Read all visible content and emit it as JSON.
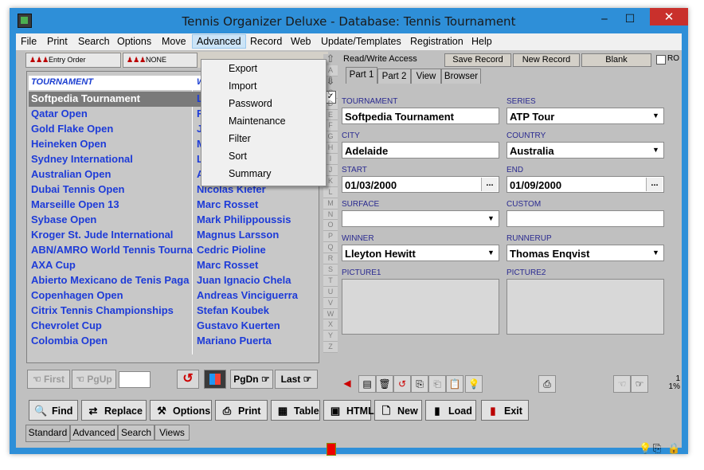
{
  "window": {
    "title": "Tennis Organizer Deluxe - Database: Tennis Tournament",
    "controls": {
      "minimize": "‒",
      "maximize": "☐",
      "close": "✕"
    }
  },
  "menu": [
    "File",
    "Print",
    "Search",
    "Options",
    "Move",
    "Advanced",
    "Record",
    "Web",
    "Update/Templates",
    "Registration",
    "Help"
  ],
  "advanced_menu": [
    "Export",
    "Import",
    "Password",
    "Maintenance",
    "Filter",
    "Sort",
    "Summary"
  ],
  "sort": {
    "entry_order": "Entry Order",
    "none": "NONE"
  },
  "grid": {
    "headers": [
      "TOURNAMENT",
      "W"
    ],
    "rows": [
      {
        "tournament": "Softpedia Tournament",
        "winner": "L"
      },
      {
        "tournament": "Qatar Open",
        "winner": "F"
      },
      {
        "tournament": "Gold Flake Open",
        "winner": "J"
      },
      {
        "tournament": "Heineken Open",
        "winner": "M"
      },
      {
        "tournament": "Sydney International",
        "winner": "L"
      },
      {
        "tournament": "Australian Open",
        "winner": "A"
      },
      {
        "tournament": "Dubai Tennis Open",
        "winner": "Nicolas Kiefer"
      },
      {
        "tournament": "Marseille Open 13",
        "winner": "Marc Rosset"
      },
      {
        "tournament": "Sybase Open",
        "winner": "Mark Philippoussis"
      },
      {
        "tournament": "Kroger St. Jude International",
        "winner": "Magnus Larsson"
      },
      {
        "tournament": "ABN/AMRO World Tennis Tourna",
        "winner": "Cedric Pioline"
      },
      {
        "tournament": "AXA Cup",
        "winner": "Marc Rosset"
      },
      {
        "tournament": "Abierto Mexicano de Tenis Paga",
        "winner": "Juan Ignacio Chela"
      },
      {
        "tournament": "Copenhagen Open",
        "winner": "Andreas Vinciguerra"
      },
      {
        "tournament": "Citrix Tennis Championships",
        "winner": "Stefan Koubek"
      },
      {
        "tournament": "Chevrolet Cup",
        "winner": "Gustavo Kuerten"
      },
      {
        "tournament": "Colombia Open",
        "winner": "Mariano Puerta"
      }
    ]
  },
  "alphabet": [
    "A",
    "B",
    "C",
    "D",
    "E",
    "F",
    "G",
    "H",
    "I",
    "J",
    "K",
    "L",
    "M",
    "N",
    "O",
    "P",
    "Q",
    "R",
    "S",
    "T",
    "U",
    "V",
    "W",
    "X",
    "Y",
    "Z"
  ],
  "nav": {
    "first": "First",
    "pgup": "PgUp",
    "pgdn": "PgDn",
    "last": "Last",
    "goto_value": ""
  },
  "record_bar": {
    "access": "Read/Write Access",
    "save": "Save Record",
    "new": "New Record",
    "blank": "Blank",
    "ro": "RO"
  },
  "tabs": [
    "Part 1",
    "Part 2",
    "View",
    "Browser"
  ],
  "form": {
    "tournament": {
      "label": "TOURNAMENT",
      "value": "Softpedia Tournament"
    },
    "series": {
      "label": "SERIES",
      "value": "ATP Tour"
    },
    "city": {
      "label": "CITY",
      "value": "Adelaide"
    },
    "country": {
      "label": "COUNTRY",
      "value": "Australia"
    },
    "start": {
      "label": "START",
      "value": "01/03/2000"
    },
    "end": {
      "label": "END",
      "value": "01/09/2000"
    },
    "surface": {
      "label": "SURFACE",
      "value": ""
    },
    "custom": {
      "label": "CUSTOM",
      "value": ""
    },
    "winner": {
      "label": "WINNER",
      "value": "Lleyton Hewitt"
    },
    "runnerup": {
      "label": "RUNNERUP",
      "value": "Thomas Enqvist"
    },
    "picture1": {
      "label": "PICTURE1"
    },
    "picture2": {
      "label": "PICTURE2"
    }
  },
  "record_position": {
    "count": "1",
    "percent": "1%"
  },
  "buttons": [
    "Find",
    "Replace",
    "Options",
    "Print",
    "Table",
    "HTML",
    "New",
    "Load",
    "Exit"
  ],
  "bottom_tabs": [
    "Standard",
    "Advanced",
    "Search",
    "Views"
  ],
  "colors": {
    "window_frame": "#2e8fd8",
    "link_text": "#1d3bd8",
    "selected_row": "#7a7a7a",
    "close": "#c9302c"
  }
}
